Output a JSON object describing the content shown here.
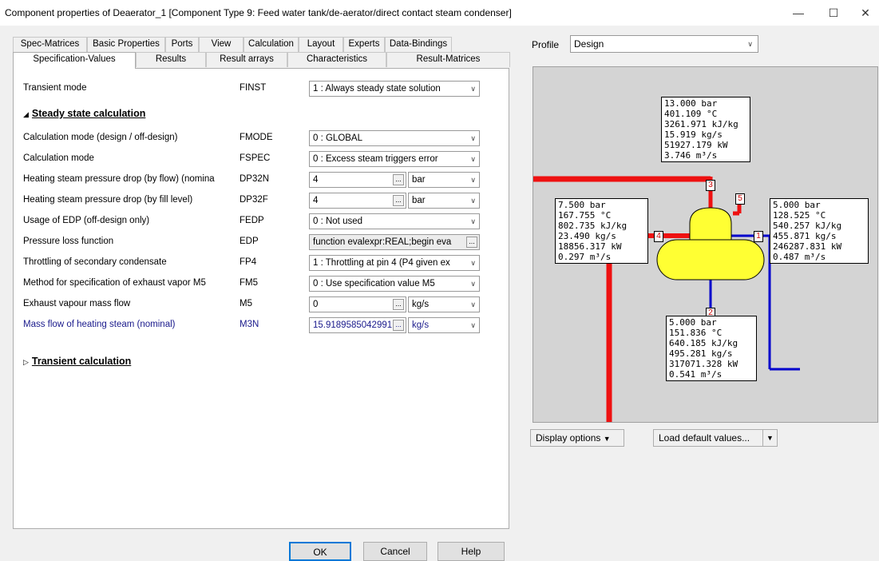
{
  "window": {
    "title": "Component properties of Deaerator_1   [Component Type 9: Feed water tank/de-aerator/direct contact steam condenser]",
    "minimize": "—",
    "maximize": "☐",
    "close": "✕"
  },
  "tabs": {
    "row1": [
      "Spec-Matrices",
      "Basic Properties",
      "Ports",
      "View",
      "Calculation",
      "Layout",
      "Experts",
      "Data-Bindings"
    ],
    "row2": [
      "Specification-Values",
      "Results",
      "Result arrays",
      "Characteristics",
      "Result-Matrices"
    ]
  },
  "spec": {
    "transient": {
      "label": "Transient mode",
      "code": "FINST",
      "value": "1 : Always steady state solution"
    },
    "section_steady": "Steady state calculation",
    "section_transient": "Transient calculation",
    "rows": [
      {
        "label": "Calculation mode (design / off-design)",
        "code": "FMODE",
        "value": "0 : GLOBAL"
      },
      {
        "label": "Calculation mode",
        "code": "FSPEC",
        "value": "0 : Excess steam triggers error"
      },
      {
        "label": "Heating steam pressure drop (by flow) (nomina",
        "code": "DP32N",
        "value": "4",
        "unit": "bar"
      },
      {
        "label": "Heating steam pressure drop (by fill level)",
        "code": "DP32F",
        "value": "4",
        "unit": "bar"
      },
      {
        "label": "Usage of EDP (off-design only)",
        "code": "FEDP",
        "value": "0 : Not used"
      },
      {
        "label": "Pressure loss function",
        "code": "EDP",
        "value": "function evalexpr:REAL;begin  eva"
      },
      {
        "label": "Throttling of secondary condensate",
        "code": "FP4",
        "value": "1 : Throttling at pin 4 (P4 given ex"
      },
      {
        "label": "Method for specification of exhaust vapor M5",
        "code": "FM5",
        "value": "0 : Use specification value M5"
      },
      {
        "label": "Exhaust vapour mass flow",
        "code": "M5",
        "value": "0",
        "unit": "kg/s"
      },
      {
        "label": "Mass flow of heating steam (nominal)",
        "code": "M3N",
        "value": "15.9189585042991",
        "unit": "kg/s"
      }
    ]
  },
  "buttons": {
    "ok": "OK",
    "cancel": "Cancel",
    "help": "Help"
  },
  "profile": {
    "label": "Profile",
    "value": "Design"
  },
  "diagram": {
    "box_top": [
      "13.000 bar",
      "401.109 °C",
      "3261.971 kJ/kg",
      "15.919 kg/s",
      "51927.179 kW",
      "3.746 m³/s"
    ],
    "box_left": [
      "7.500 bar",
      "167.755 °C",
      "802.735 kJ/kg",
      "23.490 kg/s",
      "18856.317 kW",
      "0.297 m³/s"
    ],
    "box_right": [
      "5.000 bar",
      "128.525 °C",
      "540.257 kJ/kg",
      "455.871 kg/s",
      "246287.831 kW",
      "0.487 m³/s"
    ],
    "box_bottom": [
      "5.000 bar",
      "151.836 °C",
      "640.185 kJ/kg",
      "495.281 kg/s",
      "317071.328 kW",
      "0.541 m³/s"
    ],
    "pins": [
      "1",
      "2",
      "3",
      "4",
      "5"
    ],
    "colors": {
      "steam": "#ee1111",
      "water": "#0000cc",
      "tank": "#ffff33",
      "background": "#d4d4d4"
    }
  },
  "display_options": "Display options",
  "load_defaults": "Load default values..."
}
